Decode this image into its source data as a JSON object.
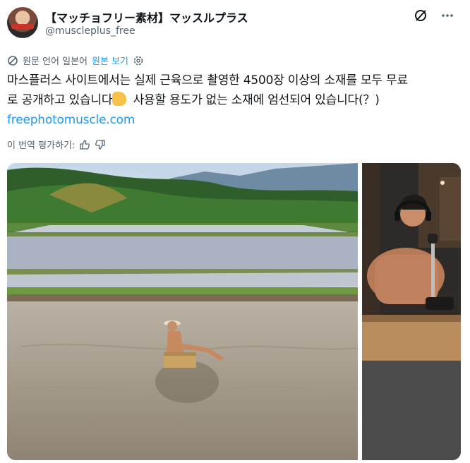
{
  "header": {
    "display_name": "【マッチョフリー素材】マッスルプラス",
    "handle": "@muscleplus_free",
    "icons": [
      "grok-icon",
      "more-options-icon"
    ]
  },
  "translation": {
    "notice": "원문 언어 일본어",
    "show_original": "원본 보기",
    "icons": [
      "translate-icon",
      "settings-gear-icon"
    ]
  },
  "tweet": {
    "line1": "마스플러스 사이트에서는 실제 근육으로 촬영한 4500장 이상의 소재를 모두 무료",
    "line2a": "로 공개하고 있습니다",
    "emoji": "flexed-biceps",
    "line2b": " 사용할 용도가 없는 소재에 엄선되어 있습니다(？)",
    "link": "freephotomuscle.com"
  },
  "rate": {
    "label": "이 번역 평가하기:",
    "icons": [
      "thumbs-up-icon",
      "thumbs-down-icon"
    ]
  },
  "media": {
    "image1": "man-sitting-on-cardboard-box-in-flooded-rice-field",
    "image2": "shirtless-man-with-headphones-at-microphone"
  },
  "colors": {
    "accent": "#1d9bf0",
    "text": "#0f1419",
    "secondary": "#536471"
  }
}
